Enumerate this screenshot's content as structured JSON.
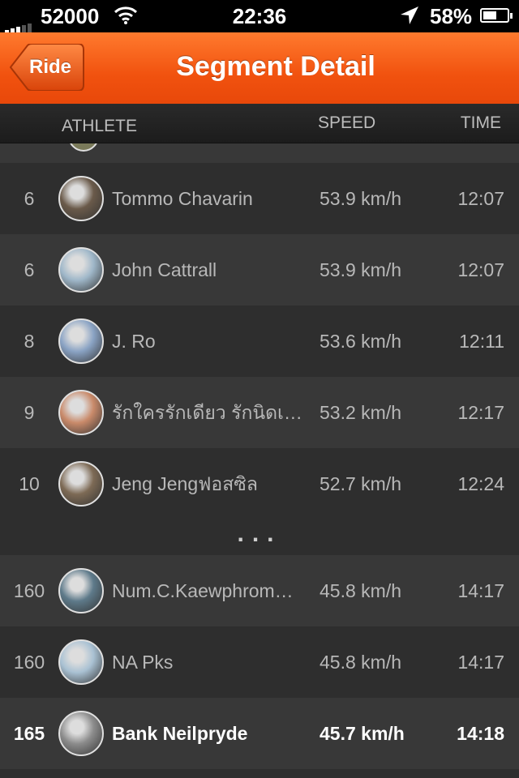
{
  "status_bar": {
    "carrier": "52000",
    "time": "22:36",
    "battery": "58%",
    "battery_level": 0.58
  },
  "nav": {
    "back_label": "Ride",
    "title": "Segment Detail"
  },
  "columns": {
    "athlete": "ATHLETE",
    "speed": "SPEED",
    "time": "TIME"
  },
  "rows_top": [
    {
      "rank": "6",
      "name": "Tommo Chavarin",
      "speed": "53.9 km/h",
      "time": "12:07",
      "avatar_color": "#6a5a4a"
    },
    {
      "rank": "6",
      "name": "John Cattrall",
      "speed": "53.9 km/h",
      "time": "12:07",
      "avatar_color": "#9fb7c9"
    },
    {
      "rank": "8",
      "name": "J. Ro",
      "speed": "53.6 km/h",
      "time": "12:11",
      "avatar_color": "#8aa3c4"
    },
    {
      "rank": "9",
      "name": "รักใครรักเดียว รักนิดเดียว…",
      "speed": "53.2 km/h",
      "time": "12:17",
      "avatar_color": "#c98a6a"
    },
    {
      "rank": "10",
      "name": "Jeng Jengฟอสซิล",
      "speed": "52.7 km/h",
      "time": "12:24",
      "avatar_color": "#7d6a55"
    }
  ],
  "gap_label": "...",
  "rows_bottom": [
    {
      "rank": "160",
      "name": "Num.C.Kaewphrom…",
      "speed": "45.8 km/h",
      "time": "14:17",
      "avatar_color": "#5e7a8a"
    },
    {
      "rank": "160",
      "name": "NA Pks",
      "speed": "45.8 km/h",
      "time": "14:17",
      "avatar_color": "#a9c1d3"
    }
  ],
  "current_athlete": {
    "rank": "165",
    "name": "Bank Neilpryde",
    "speed": "45.7 km/h",
    "time": "14:18",
    "avatar_color": "#8c8c8c"
  },
  "colors": {
    "accent": "#f1520f",
    "row_dark": "#2e2e2e",
    "row_light": "#383838",
    "text": "#b8b8b8"
  }
}
